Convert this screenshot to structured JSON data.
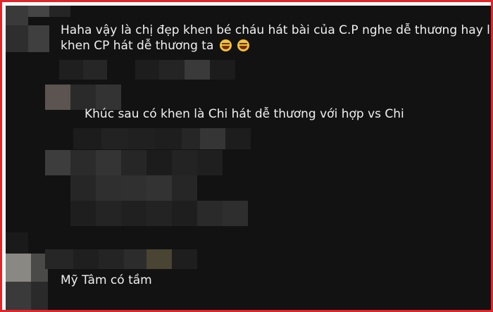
{
  "comments": [
    {
      "line1": "Haha vậy là chị đẹp khen bé cháu hát bài của C.P nghe dễ thương hay là",
      "line2": "khen CP hát dễ thương ta",
      "emoji": [
        "joy-emoji",
        "joy-emoji"
      ]
    },
    {
      "line1": "Khúc sau có khen là Chi hát dễ thương với hợp vs Chi"
    },
    {
      "line1": "Mỹ Tâm có tầm"
    }
  ],
  "colors": {
    "frame_border": "#e0262a",
    "background": "#121212",
    "text": "#f0f0f0"
  }
}
